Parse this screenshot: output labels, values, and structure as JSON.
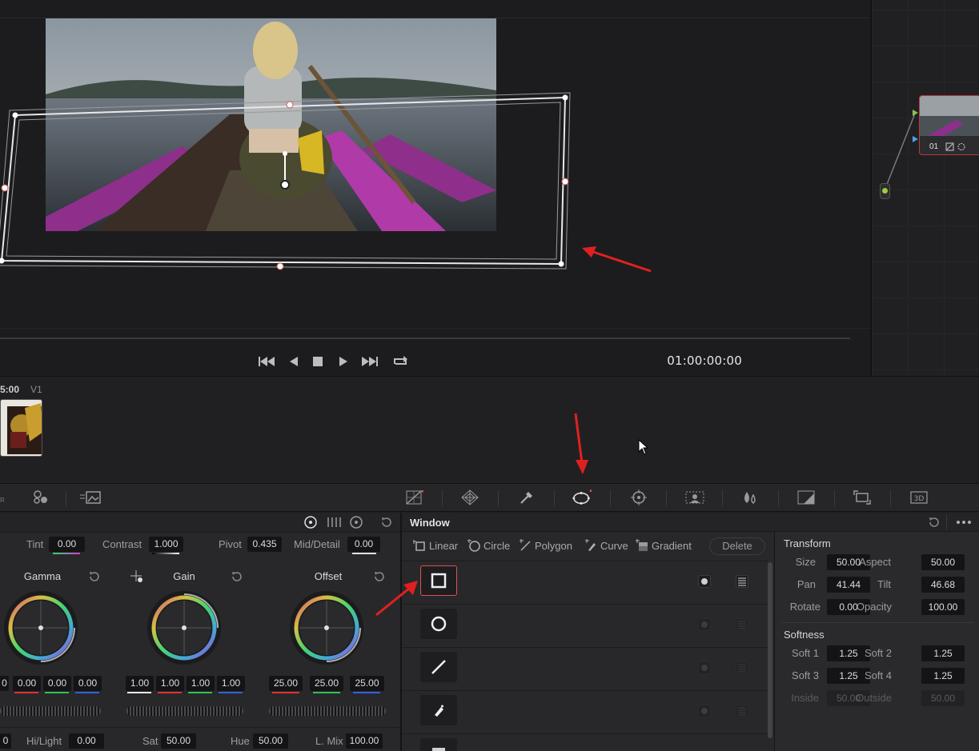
{
  "viewer": {
    "timecode": "01:00:00:00",
    "transport": [
      "skip-back-icon",
      "step-back-icon",
      "stop-icon",
      "play-icon",
      "skip-forward-icon",
      "loop-icon"
    ]
  },
  "node_graph": {
    "node_label": "01"
  },
  "timeline": {
    "clip_timecode": "5:00",
    "track": "V1"
  },
  "toolbar": {
    "icons": [
      "color-warper-icon",
      "qualifier-icon",
      "window-icon",
      "tracker-icon",
      "magic-mask-icon",
      "blur-icon",
      "key-icon",
      "sizing-icon",
      "3d-icon"
    ],
    "accent": "#d9534f"
  },
  "primaries": {
    "tint_label": "Tint",
    "tint_value": "0.00",
    "contrast_label": "Contrast",
    "contrast_value": "1.000",
    "pivot_label": "Pivot",
    "pivot_value": "0.435",
    "middetail_label": "Mid/Detail",
    "middetail_value": "0.00",
    "gamma": {
      "title": "Gamma",
      "values": [
        "0",
        "0.00",
        "0.00",
        "0.00"
      ]
    },
    "gain": {
      "title": "Gain",
      "values": [
        "1.00",
        "1.00",
        "1.00",
        "1.00"
      ]
    },
    "offset": {
      "title": "Offset",
      "values": [
        "25.00",
        "25.00",
        "25.00"
      ]
    },
    "hilight_label": "Hi/Light",
    "hilight_value": "0.00",
    "sat_label": "Sat",
    "sat_value": "50.00",
    "hue_label": "Hue",
    "hue_value": "50.00",
    "lmix_label": "L. Mix",
    "lmix_value": "100.00",
    "partial_value": "0"
  },
  "window_panel": {
    "title": "Window",
    "shapes": [
      "Linear",
      "Circle",
      "Polygon",
      "Curve",
      "Gradient"
    ],
    "delete_label": "Delete"
  },
  "transform": {
    "title": "Transform",
    "size_label": "Size",
    "size_value": "50.00",
    "aspect_label": "Aspect",
    "aspect_value": "50.00",
    "pan_label": "Pan",
    "pan_value": "41.44",
    "tilt_label": "Tilt",
    "tilt_value": "46.68",
    "rotate_label": "Rotate",
    "rotate_value": "0.00",
    "opacity_label": "Opacity",
    "opacity_value": "100.00",
    "softness_title": "Softness",
    "soft1_label": "Soft 1",
    "soft1_value": "1.25",
    "soft2_label": "Soft 2",
    "soft2_value": "1.25",
    "soft3_label": "Soft 3",
    "soft3_value": "1.25",
    "soft4_label": "Soft 4",
    "soft4_value": "1.25",
    "inside_label": "Inside",
    "inside_value": "50.00",
    "outside_label": "Outside",
    "outside_value": "50.00"
  }
}
